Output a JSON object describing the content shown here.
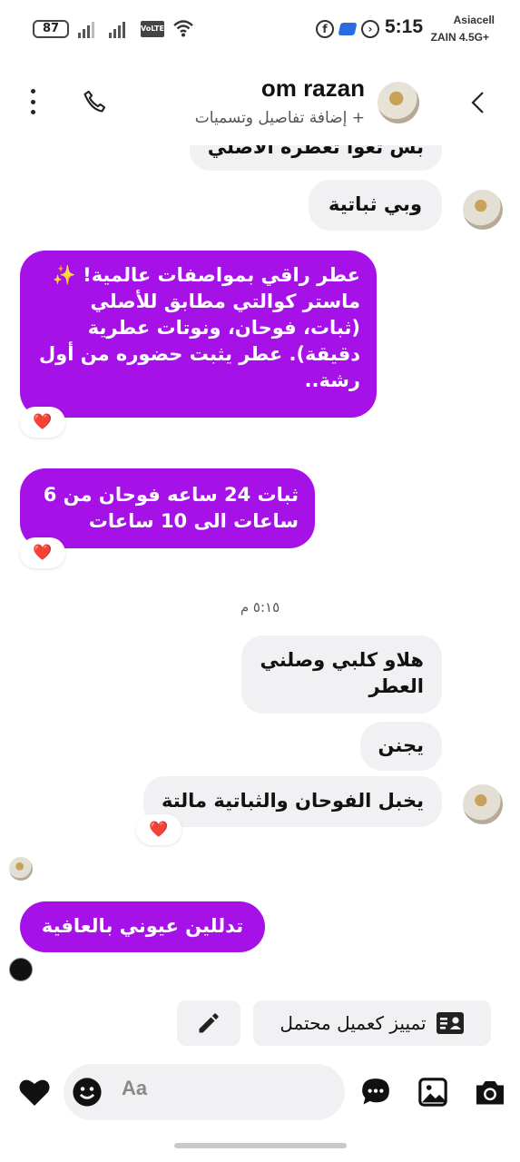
{
  "status_bar": {
    "battery": "87",
    "network_badge": "VoLTE",
    "time": "5:15",
    "carrier_top": "Asiacell",
    "carrier_bottom": "ZAIN 4.5G+"
  },
  "header": {
    "contact_name": "om razan",
    "subtitle": "+ إضافة تفاصيل وتسميات"
  },
  "messages": {
    "partial_top": "بس تعوا تعطره الاصلي",
    "m1": "وبي ثباتية",
    "out1_lines": [
      "عطر راقي بمواصفات عالمية! ✨",
      "ماستر كوالتي مطابق للأصلي",
      "(ثبات، فوحان، ونوتات عطرية",
      "دقيقة). عطر يثبت حضوره من أول",
      "رشة.."
    ],
    "out2_lines": [
      "ثبات 24 ساعه فوحان من 6",
      "ساعات الى 10 ساعات"
    ],
    "timestamp": "٥:١٥ م",
    "m2_lines": [
      "هلاو كلبي وصلني",
      "العطر"
    ],
    "m3": "يجنن",
    "m4": "يخبل الفوحان والثباتية مالتة",
    "out3": "تدللين عيوني بالعافية",
    "reaction": "❤️"
  },
  "actions": {
    "mark_lead": "تمييز كعميل محتمل"
  },
  "composer": {
    "placeholder": "Aa"
  },
  "colors": {
    "outgoing_bubble": "#a511e6",
    "incoming_bubble": "#f1f1f4"
  }
}
